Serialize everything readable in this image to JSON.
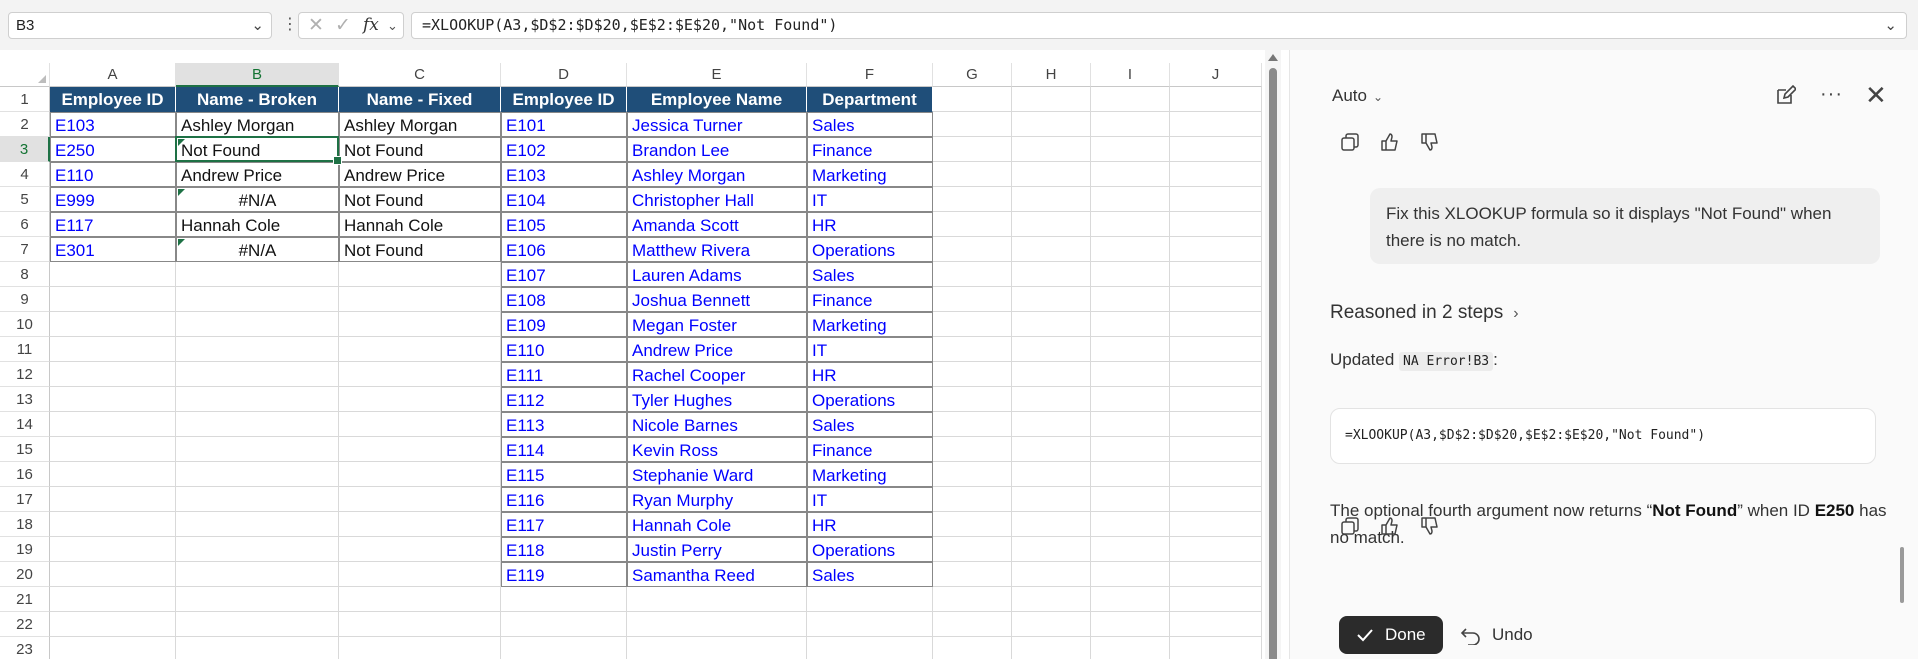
{
  "formula_bar": {
    "name_box": "B3",
    "formula": "=XLOOKUP(A3,$D$2:$D$20,$E$2:$E$20,\"Not Found\")"
  },
  "grid": {
    "columns": [
      "A",
      "B",
      "C",
      "D",
      "E",
      "F",
      "G",
      "H",
      "I",
      "J"
    ],
    "selected_column": "B",
    "rows": [
      "1",
      "2",
      "3",
      "4",
      "5",
      "6",
      "7",
      "8",
      "9",
      "10",
      "11",
      "12",
      "13",
      "14",
      "15",
      "16",
      "17",
      "18",
      "19",
      "20",
      "21",
      "22",
      "23"
    ],
    "selected_row": "3",
    "active_cell": "B3",
    "headers": [
      "Employee ID",
      "Name - Broken",
      "Name - Fixed",
      "Employee ID",
      "Employee Name",
      "Department"
    ],
    "lookup_ids": [
      "E103",
      "E250",
      "E110",
      "E999",
      "E117",
      "E301"
    ],
    "name_broken": [
      "Ashley Morgan",
      "Not Found",
      "Andrew Price",
      "#N/A",
      "Hannah Cole",
      "#N/A"
    ],
    "name_fixed": [
      "Ashley Morgan",
      "Not Found",
      "Andrew Price",
      "Not Found",
      "Hannah Cole",
      "Not Found"
    ],
    "table_ids": [
      "E101",
      "E102",
      "E103",
      "E104",
      "E105",
      "E106",
      "E107",
      "E108",
      "E109",
      "E110",
      "E111",
      "E112",
      "E113",
      "E114",
      "E115",
      "E116",
      "E117",
      "E118",
      "E119"
    ],
    "table_names": [
      "Jessica Turner",
      "Brandon Lee",
      "Ashley Morgan",
      "Christopher Hall",
      "Amanda Scott",
      "Matthew Rivera",
      "Lauren Adams",
      "Joshua Bennett",
      "Megan Foster",
      "Andrew Price",
      "Rachel Cooper",
      "Tyler Hughes",
      "Nicole Barnes",
      "Kevin Ross",
      "Stephanie Ward",
      "Ryan Murphy",
      "Hannah Cole",
      "Justin Perry",
      "Samantha Reed"
    ],
    "table_departments": [
      "Sales",
      "Finance",
      "Marketing",
      "IT",
      "HR",
      "Operations",
      "Sales",
      "Finance",
      "Marketing",
      "IT",
      "HR",
      "Operations",
      "Sales",
      "Finance",
      "Marketing",
      "IT",
      "HR",
      "Operations",
      "Sales"
    ]
  },
  "copilot": {
    "model_label": "Auto",
    "user_message": "Fix this XLOOKUP formula so it displays \"Not Found\" when there is no match.",
    "reasoned_label": "Reasoned in 2 steps",
    "updated_prefix": "Updated",
    "updated_ref": "NA Error!B3",
    "updated_suffix": ":",
    "code": "=XLOOKUP(A3,$D$2:$D$20,$E$2:$E$20,\"Not Found\")",
    "answer": {
      "part1": "The optional fourth argument now returns “",
      "bold1": "Not Found",
      "part2": "” when ID ",
      "bold2": "E250",
      "part3": " has no match."
    },
    "done_label": "Done",
    "undo_label": "Undo"
  },
  "colors": {
    "header_fill": "#1f4e79",
    "link_blue": "#0000ff",
    "selection_green": "#1e7145"
  }
}
